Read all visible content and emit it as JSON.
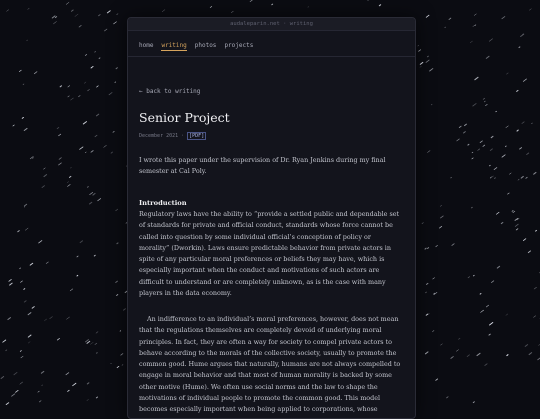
{
  "window": {
    "title": "audaleparin.net · writing"
  },
  "nav": {
    "items": [
      "home",
      "writing",
      "photos",
      "projects"
    ],
    "active": "writing"
  },
  "back_link": "← back to writing",
  "post": {
    "title": "Senior Project",
    "date": "December 2021 ·",
    "pdf_label": "[PDF]",
    "intro": "I wrote this paper under the supervision of Dr. Ryan Jenkins during my final semester at Cal Poly.",
    "section_heading": "Introduction",
    "paragraph_1": "Regulatory laws have the ability to “provide a settled public and dependable set of standards for private and official conduct, standards whose force cannot be called into question by some individual official’s conception of policy or morality” (Dworkin). Laws ensure predictable behavior from private actors in spite of any particular moral preferences or beliefs they may have, which is especially important when the conduct and motivations of such actors are difficult to understand or are completely unknown, as is the case with many players in the data economy.",
    "paragraph_2": "An indifference to an individual’s moral preferences, however, does not mean that the regulations themselves are completely devoid of underlying moral principles. In fact, they are often a way for society to compel private actors to behave according to the morals of the collective society, usually to promote the common good. Hume argues that naturally, humans are not always compelled to engage in moral behavior and that most of human morality is backed by some other motive (Hume). We often use social norms and the law to shape the motivations of individual people to promote the common good. This model becomes especially important when being applied to corporations, whose primary motivation is profit."
  },
  "colors": {
    "accent": "#d6a45d",
    "panel_bg": "#13141c",
    "background": "#0b0c12"
  }
}
